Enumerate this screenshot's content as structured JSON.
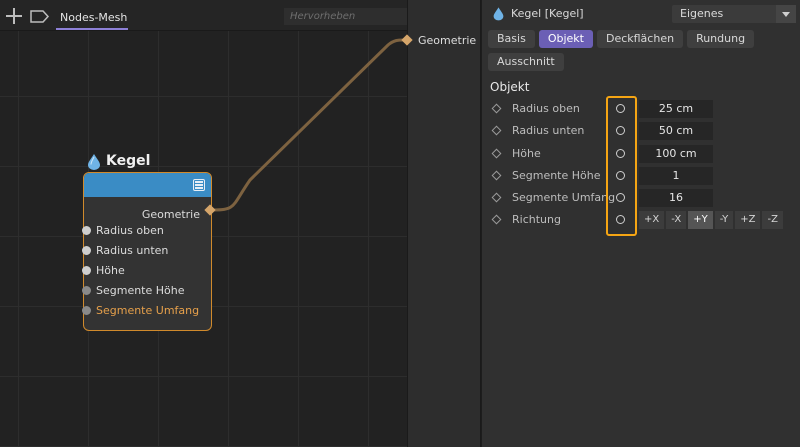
{
  "editor": {
    "tab_label": "Nodes-Mesh",
    "search_placeholder": "Hervorheben"
  },
  "node": {
    "title": "Kegel",
    "output_label": "Geometrie",
    "inputs": [
      {
        "label": "Radius oben"
      },
      {
        "label": "Radius unten"
      },
      {
        "label": "Höhe"
      },
      {
        "label": "Segmente Höhe"
      },
      {
        "label": "Segmente Umfang"
      }
    ]
  },
  "output_port": {
    "label": "Geometrie"
  },
  "attributes": {
    "object_title": "Kegel [Kegel]",
    "mode": "Eigenes",
    "tabs": [
      "Basis",
      "Objekt",
      "Deckflächen",
      "Rundung",
      "Ausschnitt"
    ],
    "active_tab": "Objekt",
    "section_title": "Objekt",
    "params": [
      {
        "label": "Radius oben",
        "value": "25 cm"
      },
      {
        "label": "Radius unten",
        "value": "50 cm"
      },
      {
        "label": "Höhe",
        "value": "100 cm"
      },
      {
        "label": "Segmente Höhe",
        "value": "1"
      },
      {
        "label": "Segmente Umfang",
        "value": "16"
      },
      {
        "label": "Richtung"
      }
    ],
    "direction_options": [
      "+X",
      "-X",
      "+Y",
      "-Y",
      "+Z",
      "-Z"
    ],
    "direction_selected": "+Y"
  },
  "colors": {
    "node_header": "#3a8cc5",
    "node_border": "#d08a2c",
    "active_tab": "#6b5fb5",
    "highlight": "#f5a514",
    "wire": "#8a6a3e"
  }
}
